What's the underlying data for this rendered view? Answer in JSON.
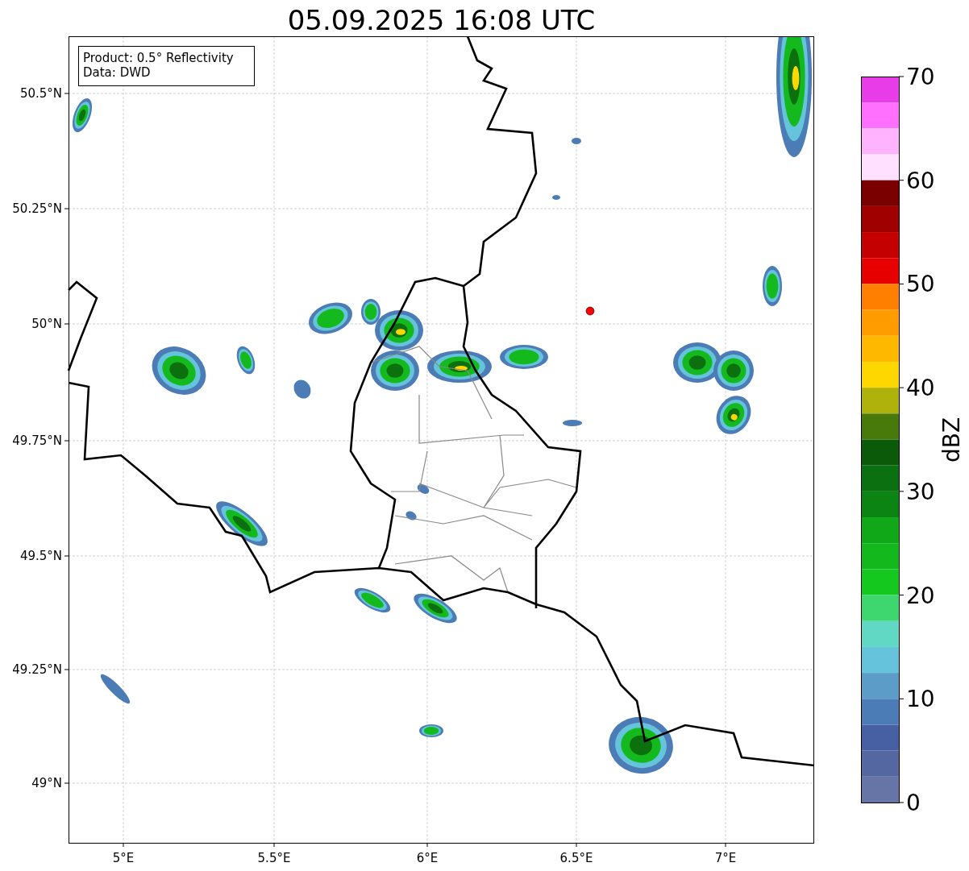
{
  "title": "05.09.2025 16:08 UTC",
  "info_box": {
    "lines": [
      "Product: 0.5° Reflectivity",
      "Data: DWD"
    ]
  },
  "map": {
    "lat_ticks": [
      "50.5°N",
      "50.25°N",
      "50°N",
      "49.75°N",
      "49.5°N",
      "49.25°N",
      "49°N"
    ],
    "lon_ticks": [
      "5°E",
      "5.5°E",
      "6°E",
      "6.5°E",
      "7°E"
    ]
  },
  "colorbar": {
    "label": "dBZ",
    "ticks": [
      "70",
      "60",
      "50",
      "40",
      "30",
      "20",
      "10",
      "0"
    ],
    "bins": [
      {
        "color": "#e83ce8"
      },
      {
        "color": "#ff70ff"
      },
      {
        "color": "#ffb3ff"
      },
      {
        "color": "#ffe0ff"
      },
      {
        "color": "#7a0000"
      },
      {
        "color": "#a00000"
      },
      {
        "color": "#c40000"
      },
      {
        "color": "#e60000"
      },
      {
        "color": "#ff7f00"
      },
      {
        "color": "#ff9d00"
      },
      {
        "color": "#ffb800"
      },
      {
        "color": "#ffd700"
      },
      {
        "color": "#aeb20a"
      },
      {
        "color": "#477a0a"
      },
      {
        "color": "#0a5a0a"
      },
      {
        "color": "#0b7010"
      },
      {
        "color": "#0c8414"
      },
      {
        "color": "#10a818"
      },
      {
        "color": "#12b81c"
      },
      {
        "color": "#14c81e"
      },
      {
        "color": "#3ed66e"
      },
      {
        "color": "#60d8c4"
      },
      {
        "color": "#66c3dc"
      },
      {
        "color": "#5b9dc8"
      },
      {
        "color": "#4c7cb5"
      },
      {
        "color": "#4660a3"
      },
      {
        "color": "#5467a0"
      },
      {
        "color": "#6675a6"
      }
    ]
  }
}
